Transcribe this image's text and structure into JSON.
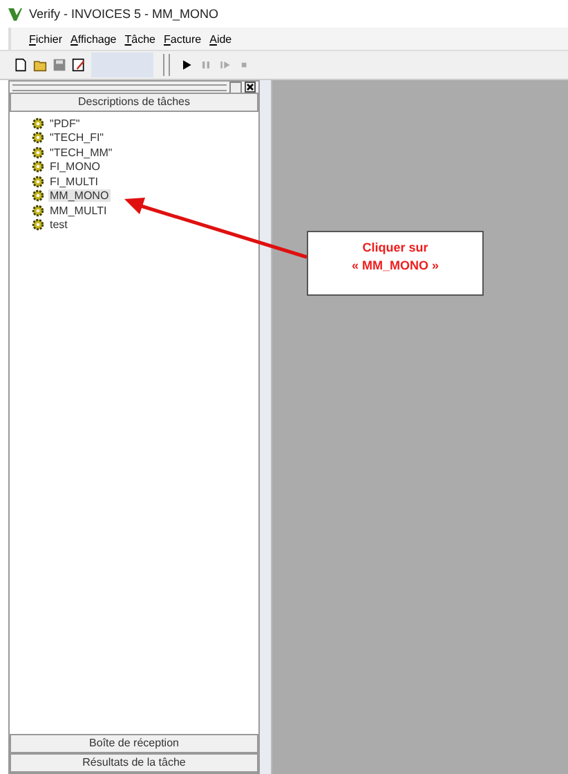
{
  "window": {
    "title": "Verify - INVOICES 5 - MM_MONO"
  },
  "menu": [
    "Fichier",
    "Affichage",
    "Tâche",
    "Facture",
    "Aide"
  ],
  "panel": {
    "header": "Descriptions de tâches",
    "items": [
      {
        "label": "\"PDF\"",
        "selected": false
      },
      {
        "label": "\"TECH_FI\"",
        "selected": false
      },
      {
        "label": "\"TECH_MM\"",
        "selected": false
      },
      {
        "label": "FI_MONO",
        "selected": false
      },
      {
        "label": "FI_MULTI",
        "selected": false
      },
      {
        "label": "MM_MONO",
        "selected": true
      },
      {
        "label": "MM_MULTI",
        "selected": false
      },
      {
        "label": "test",
        "selected": false
      }
    ],
    "bottom_bars": [
      "Boîte de réception",
      "Résultats de la tâche"
    ]
  },
  "callout": {
    "lines": [
      "Cliquer sur",
      "« MM_MONO »"
    ]
  }
}
